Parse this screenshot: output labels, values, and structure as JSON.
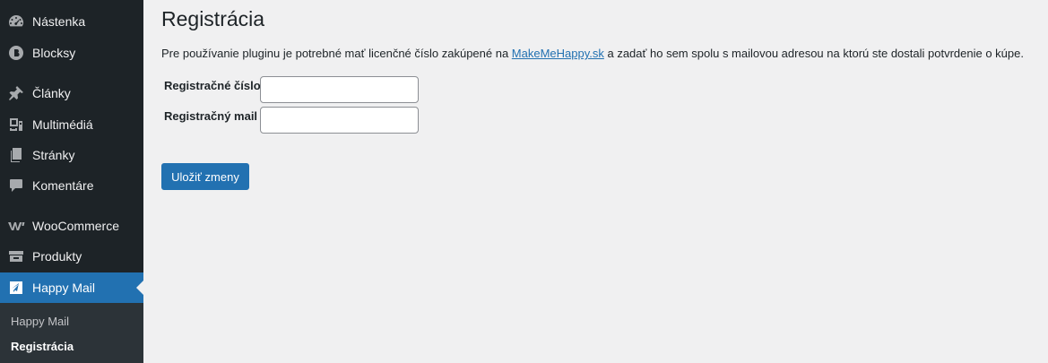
{
  "sidebar": {
    "items": [
      {
        "label": "Nástenka",
        "icon": "dashboard-icon"
      },
      {
        "label": "Blocksy",
        "icon": "blocksy-icon"
      },
      {
        "label": "Články",
        "icon": "pin-icon"
      },
      {
        "label": "Multimédiá",
        "icon": "media-icon"
      },
      {
        "label": "Stránky",
        "icon": "pages-icon"
      },
      {
        "label": "Komentáre",
        "icon": "comments-icon"
      },
      {
        "label": "WooCommerce",
        "icon": "woocommerce-icon"
      },
      {
        "label": "Produkty",
        "icon": "products-icon"
      },
      {
        "label": "Happy Mail",
        "icon": "paper-plane-icon",
        "current": true
      }
    ],
    "submenu": [
      {
        "label": "Happy Mail"
      },
      {
        "label": "Registrácia",
        "current": true
      }
    ]
  },
  "page": {
    "title": "Registrácia",
    "description_before": "Pre používanie pluginu je potrebné mať licenčné číslo zakúpené na ",
    "link_text": "MakeMeHappy.sk",
    "description_after": " a zadať ho sem spolu s mailovou adresou na ktorú ste dostali potvrdenie o kúpe."
  },
  "form": {
    "fields": [
      {
        "label": "Registračné číslo",
        "value": ""
      },
      {
        "label": "Registračný mail",
        "value": ""
      }
    ],
    "submit_label": "Uložiť zmeny"
  },
  "colors": {
    "sidebar_bg": "#1d2327",
    "accent": "#2271b1",
    "page_bg": "#f0f0f1"
  }
}
